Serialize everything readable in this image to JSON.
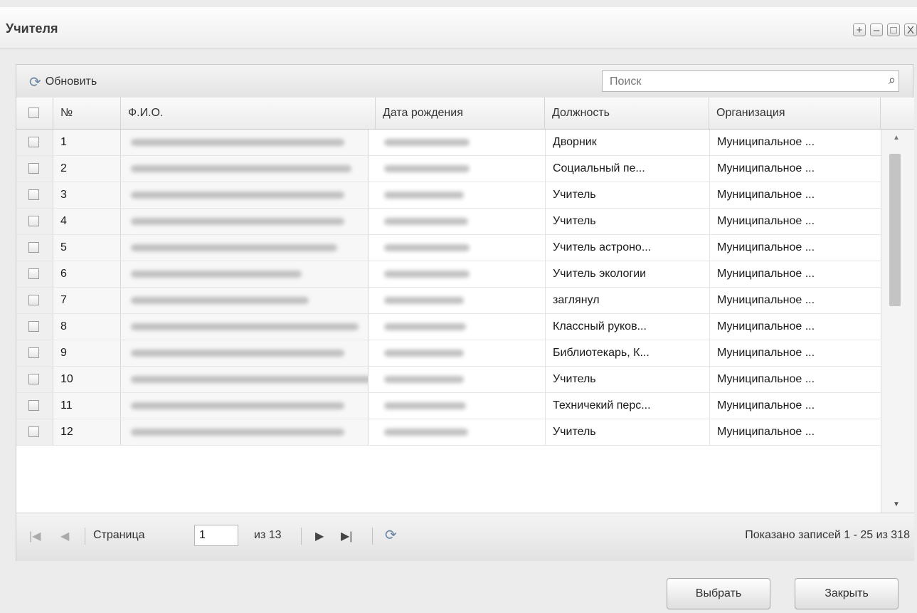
{
  "window": {
    "title": "Учителя",
    "buttons": {
      "add": "+",
      "minimize": "–",
      "maximize": "□",
      "close": "X"
    }
  },
  "toolbar": {
    "refresh_label": "Обновить",
    "refresh_icon": "refresh-icon"
  },
  "search": {
    "placeholder": "Поиск",
    "value": ""
  },
  "table": {
    "columns": {
      "num": "№",
      "fio": "Ф.И.О.",
      "birth_date": "Дата рождения",
      "position": "Должность",
      "organization": "Организация"
    },
    "rows": [
      {
        "num": "1",
        "position": "Дворник",
        "organization": "Муниципальное ..."
      },
      {
        "num": "2",
        "position": "Социальный пе...",
        "organization": "Муниципальное ..."
      },
      {
        "num": "3",
        "position": "Учитель",
        "organization": "Муниципальное ..."
      },
      {
        "num": "4",
        "position": "Учитель",
        "organization": "Муниципальное ..."
      },
      {
        "num": "5",
        "position": "Учитель астроно...",
        "organization": "Муниципальное ..."
      },
      {
        "num": "6",
        "position": "Учитель экологии",
        "organization": "Муниципальное ..."
      },
      {
        "num": "7",
        "position": "заглянул",
        "organization": "Муниципальное ..."
      },
      {
        "num": "8",
        "position": "Классный руков...",
        "organization": "Муниципальное ..."
      },
      {
        "num": "9",
        "position": "Библиотекарь, К...",
        "organization": "Муниципальное ..."
      },
      {
        "num": "10",
        "position": "Учитель",
        "organization": "Муниципальное ..."
      },
      {
        "num": "11",
        "position": "Техничекий перс...",
        "organization": "Муниципальное ..."
      },
      {
        "num": "12",
        "position": "Учитель",
        "organization": "Муниципальное ..."
      }
    ]
  },
  "pager": {
    "page_label": "Страница",
    "page_value": "1",
    "of_label": "из 13",
    "summary": "Показано записей 1 - 25 из 318"
  },
  "footer": {
    "select_label": "Выбрать",
    "close_label": "Закрыть"
  },
  "colors": {
    "title": "#3a3a3a",
    "panel": "#e6e6e6",
    "accent_icon": "#6a86a6"
  }
}
